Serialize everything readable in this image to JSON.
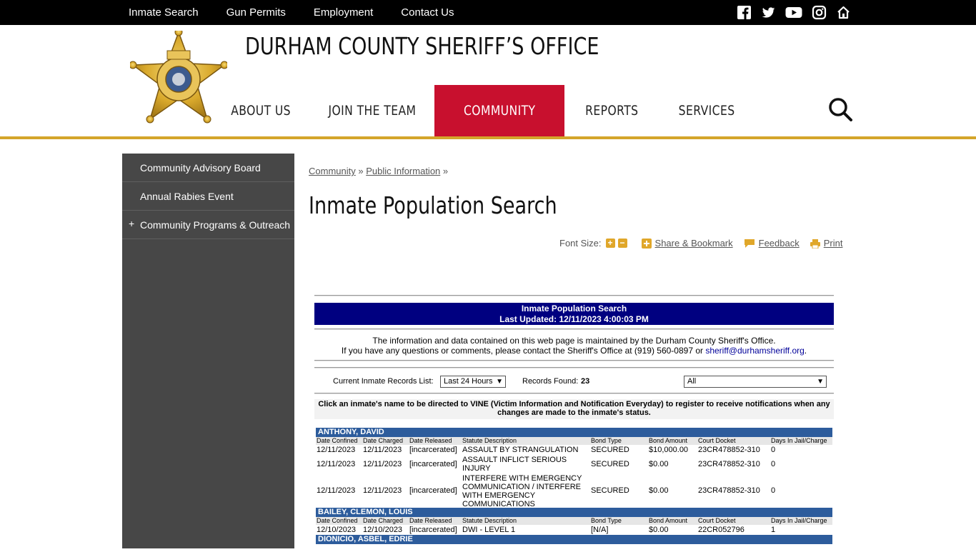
{
  "topbar": {
    "links": [
      "Inmate Search",
      "Gun Permits",
      "Employment",
      "Contact Us"
    ],
    "social_icons": [
      "facebook-icon",
      "twitter-icon",
      "youtube-icon",
      "instagram-icon",
      "home-icon"
    ]
  },
  "header": {
    "title": "DURHAM COUNTY SHERIFF’S OFFICE",
    "nav": [
      {
        "label": "ABOUT US",
        "active": false
      },
      {
        "label": "JOIN THE TEAM",
        "active": false
      },
      {
        "label": "COMMUNITY",
        "active": true
      },
      {
        "label": "REPORTS",
        "active": false
      },
      {
        "label": "SERVICES",
        "active": false
      }
    ],
    "accent_color": "#c8102e",
    "gold_color": "#d4a52a"
  },
  "sidebar": {
    "items": [
      {
        "label": "Community Advisory Board",
        "expandable": false
      },
      {
        "label": "Annual Rabies Event",
        "expandable": false
      },
      {
        "label": "Community Programs & Outreach",
        "expandable": true
      }
    ]
  },
  "breadcrumb": {
    "items": [
      "Community",
      "Public Information"
    ],
    "separator": "»"
  },
  "page": {
    "title": "Inmate Population Search"
  },
  "tools": {
    "font_size_label": "Font Size:",
    "increase": "+",
    "decrease": "−",
    "share": "Share & Bookmark",
    "feedback": "Feedback",
    "print": "Print"
  },
  "app": {
    "title_line1": "Inmate Population Search",
    "title_line2": "Last Updated: 12/11/2023 4:00:03 PM",
    "info_line1": "The information and data contained on this web page is maintained by the Durham County Sheriff's Office.",
    "info_line2_prefix": "If you have any questions or comments, please contact the Sheriff's Office at (919) 560-0897 or ",
    "info_email": "sheriff@durhamsheriff.org",
    "info_line2_suffix": ".",
    "list_label": "Current Inmate Records List:",
    "list_value": "Last 24 Hours",
    "records_label": "Records Found:",
    "records_count": "23",
    "filter_value": "All",
    "note": "Click an inmate's name to be directed to VINE (Victim Information and Notification Everyday) to register to receive notifications when any changes are made to the inmate's status.",
    "columns": [
      "Date Confined",
      "Date Charged",
      "Date Released",
      "Statute Description",
      "Bond Type",
      "Bond Amount",
      "Court Docket",
      "Days In Jail/Charge"
    ],
    "inmates": [
      {
        "name": "ANTHONY, DAVID",
        "rows": [
          [
            "12/11/2023",
            "12/11/2023",
            "[incarcerated]",
            "ASSAULT BY STRANGULATION",
            "SECURED",
            "$10,000.00",
            "23CR478852-310",
            "0"
          ],
          [
            "12/11/2023",
            "12/11/2023",
            "[incarcerated]",
            "ASSAULT INFLICT SERIOUS INJURY",
            "SECURED",
            "$0.00",
            "23CR478852-310",
            "0"
          ],
          [
            "12/11/2023",
            "12/11/2023",
            "[incarcerated]",
            "INTERFERE WITH EMERGENCY COMMUNICATION / INTERFERE WITH EMERGENCY COMMUNICATIONS",
            "SECURED",
            "$0.00",
            "23CR478852-310",
            "0"
          ]
        ]
      },
      {
        "name": "BAILEY, CLEMON, LOUIS",
        "rows": [
          [
            "12/10/2023",
            "12/10/2023",
            "[incarcerated]",
            "DWI - LEVEL 1",
            "[N/A]",
            "$0.00",
            "22CR052796",
            "1"
          ]
        ]
      },
      {
        "name": "DIONICIO, ASBEL, EDRIE",
        "rows": []
      }
    ]
  }
}
